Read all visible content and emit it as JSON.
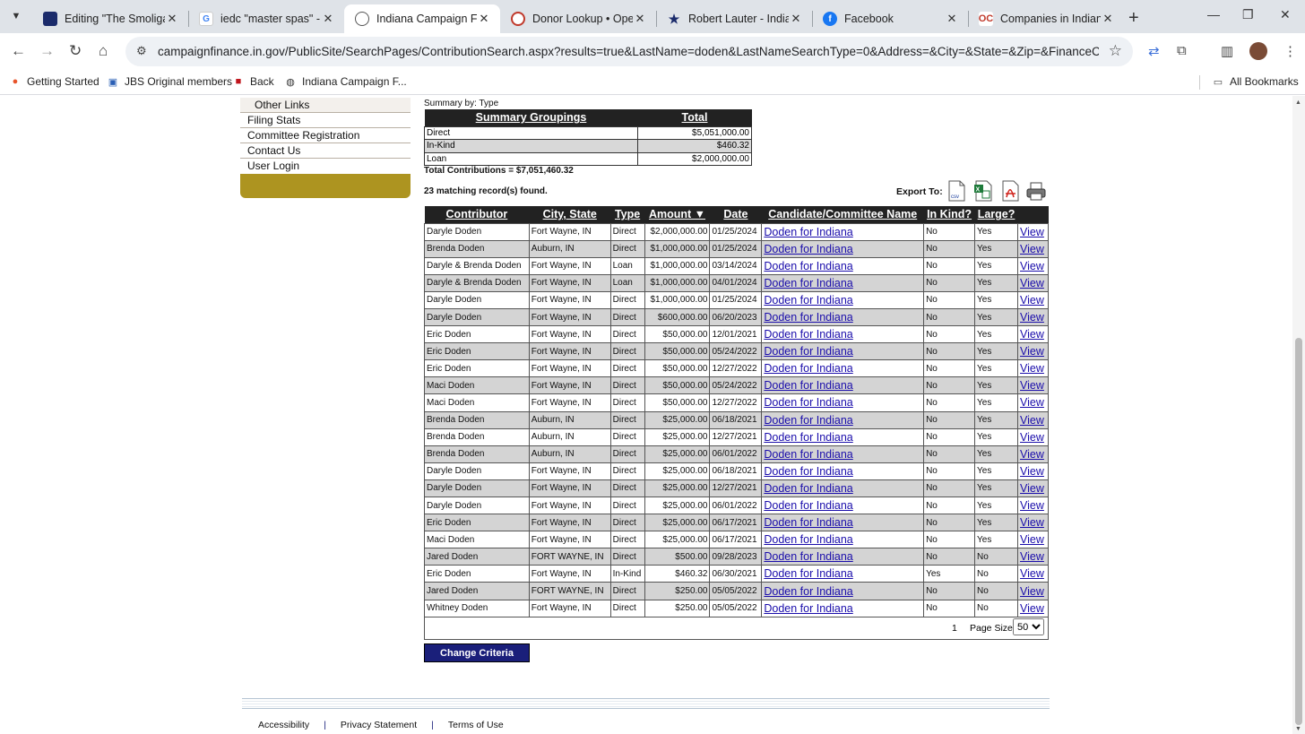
{
  "browser": {
    "tabs": [
      {
        "title": "Editing \"The Smoligarc",
        "icon": "substack-icon"
      },
      {
        "title": "iedc \"master spas\" - Go",
        "icon": "google-icon"
      },
      {
        "title": "Indiana Campaign Fina",
        "icon": "globe-icon"
      },
      {
        "title": "Donor Lookup • Opens",
        "icon": "opensecrets-icon"
      },
      {
        "title": "Robert Lauter - Indiana",
        "icon": "star-icon"
      },
      {
        "title": "Facebook",
        "icon": "facebook-icon"
      },
      {
        "title": "Companies in Indiana",
        "icon": "opencorporates-icon"
      }
    ],
    "url": "campaignfinance.in.gov/PublicSite/SearchPages/ContributionSearch.aspx?results=true&LastName=doden&LastNameSearchType=0&Address=&City=&State=&Zip=&FinanceCategoryID...",
    "bookmarks": [
      "Getting Started",
      "JBS Original members",
      "Back",
      "Indiana Campaign F..."
    ],
    "all_bookmarks": "All Bookmarks"
  },
  "leftnav": {
    "items": [
      "Other Links",
      "Filing Stats",
      "Committee Registration",
      "Contact Us",
      "User Login"
    ]
  },
  "summary": {
    "label": "Summary by: Type",
    "headers": [
      "Summary Groupings",
      "Total"
    ],
    "rows": [
      {
        "group": "Direct",
        "total": "$5,051,000.00"
      },
      {
        "group": "In-Kind",
        "total": "$460.32"
      },
      {
        "group": "Loan",
        "total": "$2,000,000.00"
      }
    ],
    "total_contributions": "Total Contributions = $7,051,460.32"
  },
  "results": {
    "matching": "23 matching record(s) found.",
    "export_label": "Export To:",
    "headers": [
      "Contributor",
      "City, State",
      "Type",
      "Amount ▼",
      "Date",
      "Candidate/Committee Name",
      "In Kind?",
      "Large?",
      ""
    ],
    "rows": [
      [
        "Daryle Doden",
        "Fort Wayne, IN",
        "Direct",
        "$2,000,000.00",
        "01/25/2024",
        "Doden for Indiana",
        "No",
        "Yes",
        "View"
      ],
      [
        "Brenda Doden",
        "Auburn, IN",
        "Direct",
        "$1,000,000.00",
        "01/25/2024",
        "Doden for Indiana",
        "No",
        "Yes",
        "View"
      ],
      [
        "Daryle & Brenda Doden",
        "Fort Wayne, IN",
        "Loan",
        "$1,000,000.00",
        "03/14/2024",
        "Doden for Indiana",
        "No",
        "Yes",
        "View"
      ],
      [
        "Daryle & Brenda Doden",
        "Fort Wayne, IN",
        "Loan",
        "$1,000,000.00",
        "04/01/2024",
        "Doden for Indiana",
        "No",
        "Yes",
        "View"
      ],
      [
        "Daryle Doden",
        "Fort Wayne, IN",
        "Direct",
        "$1,000,000.00",
        "01/25/2024",
        "Doden for Indiana",
        "No",
        "Yes",
        "View"
      ],
      [
        "Daryle Doden",
        "Fort Wayne, IN",
        "Direct",
        "$600,000.00",
        "06/20/2023",
        "Doden for Indiana",
        "No",
        "Yes",
        "View"
      ],
      [
        "Eric Doden",
        "Fort Wayne, IN",
        "Direct",
        "$50,000.00",
        "12/01/2021",
        "Doden for Indiana",
        "No",
        "Yes",
        "View"
      ],
      [
        "Eric Doden",
        "Fort Wayne, IN",
        "Direct",
        "$50,000.00",
        "05/24/2022",
        "Doden for Indiana",
        "No",
        "Yes",
        "View"
      ],
      [
        "Eric Doden",
        "Fort Wayne, IN",
        "Direct",
        "$50,000.00",
        "12/27/2022",
        "Doden for Indiana",
        "No",
        "Yes",
        "View"
      ],
      [
        "Maci Doden",
        "Fort Wayne, IN",
        "Direct",
        "$50,000.00",
        "05/24/2022",
        "Doden for Indiana",
        "No",
        "Yes",
        "View"
      ],
      [
        "Maci Doden",
        "Fort Wayne, IN",
        "Direct",
        "$50,000.00",
        "12/27/2022",
        "Doden for Indiana",
        "No",
        "Yes",
        "View"
      ],
      [
        "Brenda Doden",
        "Auburn, IN",
        "Direct",
        "$25,000.00",
        "06/18/2021",
        "Doden for Indiana",
        "No",
        "Yes",
        "View"
      ],
      [
        "Brenda Doden",
        "Auburn, IN",
        "Direct",
        "$25,000.00",
        "12/27/2021",
        "Doden for Indiana",
        "No",
        "Yes",
        "View"
      ],
      [
        "Brenda Doden",
        "Auburn, IN",
        "Direct",
        "$25,000.00",
        "06/01/2022",
        "Doden for Indiana",
        "No",
        "Yes",
        "View"
      ],
      [
        "Daryle Doden",
        "Fort Wayne, IN",
        "Direct",
        "$25,000.00",
        "06/18/2021",
        "Doden for Indiana",
        "No",
        "Yes",
        "View"
      ],
      [
        "Daryle Doden",
        "Fort Wayne, IN",
        "Direct",
        "$25,000.00",
        "12/27/2021",
        "Doden for Indiana",
        "No",
        "Yes",
        "View"
      ],
      [
        "Daryle Doden",
        "Fort Wayne, IN",
        "Direct",
        "$25,000.00",
        "06/01/2022",
        "Doden for Indiana",
        "No",
        "Yes",
        "View"
      ],
      [
        "Eric Doden",
        "Fort Wayne, IN",
        "Direct",
        "$25,000.00",
        "06/17/2021",
        "Doden for Indiana",
        "No",
        "Yes",
        "View"
      ],
      [
        "Maci Doden",
        "Fort Wayne, IN",
        "Direct",
        "$25,000.00",
        "06/17/2021",
        "Doden for Indiana",
        "No",
        "Yes",
        "View"
      ],
      [
        "Jared Doden",
        "FORT WAYNE, IN",
        "Direct",
        "$500.00",
        "09/28/2023",
        "Doden for Indiana",
        "No",
        "No",
        "View"
      ],
      [
        "Eric Doden",
        "Fort Wayne, IN",
        "In-Kind",
        "$460.32",
        "06/30/2021",
        "Doden for Indiana",
        "Yes",
        "No",
        "View"
      ],
      [
        "Jared Doden",
        "FORT WAYNE, IN",
        "Direct",
        "$250.00",
        "05/05/2022",
        "Doden for Indiana",
        "No",
        "No",
        "View"
      ],
      [
        "Whitney Doden",
        "Fort Wayne, IN",
        "Direct",
        "$250.00",
        "05/05/2022",
        "Doden for Indiana",
        "No",
        "No",
        "View"
      ]
    ],
    "page_number": "1",
    "page_size_label": "Page Size:",
    "page_size": "50"
  },
  "change_criteria": "Change Criteria",
  "footer": {
    "links": [
      "Accessibility",
      "Privacy Statement",
      "Terms of Use"
    ]
  }
}
